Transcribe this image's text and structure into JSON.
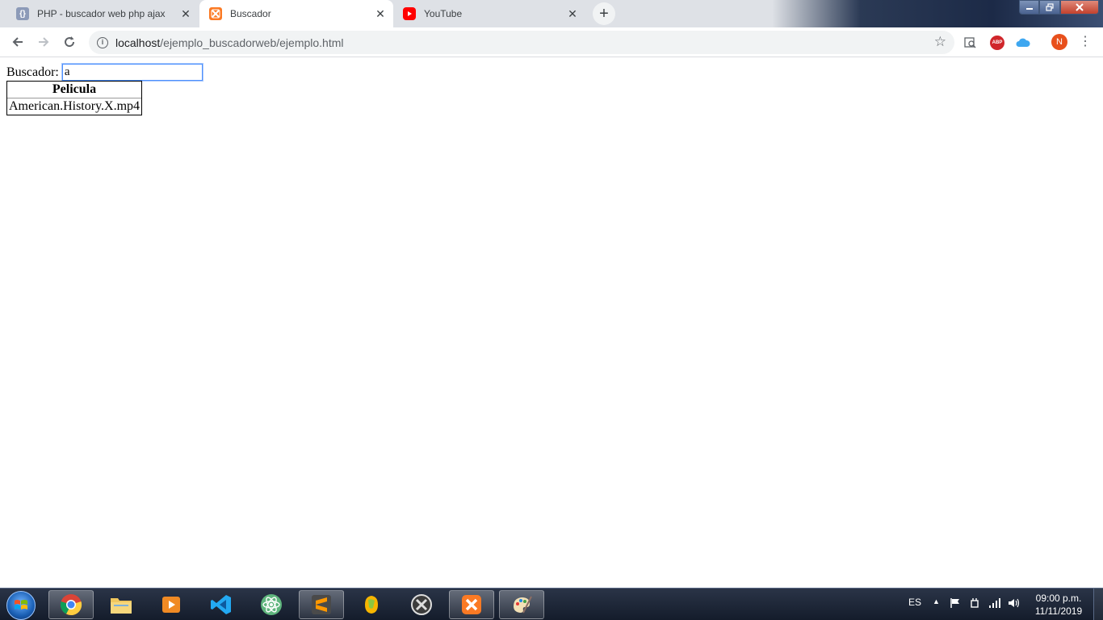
{
  "browser": {
    "tabs": [
      {
        "title": "PHP - buscador web php ajax",
        "icon": "code-brackets-icon",
        "active": false
      },
      {
        "title": "Buscador",
        "icon": "xampp-icon",
        "active": true
      },
      {
        "title": "YouTube",
        "icon": "youtube-icon",
        "active": false
      }
    ],
    "close_glyph": "✕",
    "newtab_glyph": "+",
    "url_host": "localhost",
    "url_path": "/ejemplo_buscadorweb/ejemplo.html",
    "profile_initial": "N",
    "ext_abp_label": "ABP"
  },
  "page": {
    "search_label": "Buscador:",
    "search_value": "a",
    "table_header": "Pelicula",
    "rows": [
      "American.History.X.mp4"
    ]
  },
  "taskbar": {
    "language": "ES",
    "time": "09:00 p.m.",
    "date": "11/11/2019"
  },
  "colors": {
    "accent_blue": "#4d90fe",
    "youtube_red": "#ff0000",
    "xampp_orange": "#fb7a24",
    "profile_orange": "#e8501c"
  }
}
